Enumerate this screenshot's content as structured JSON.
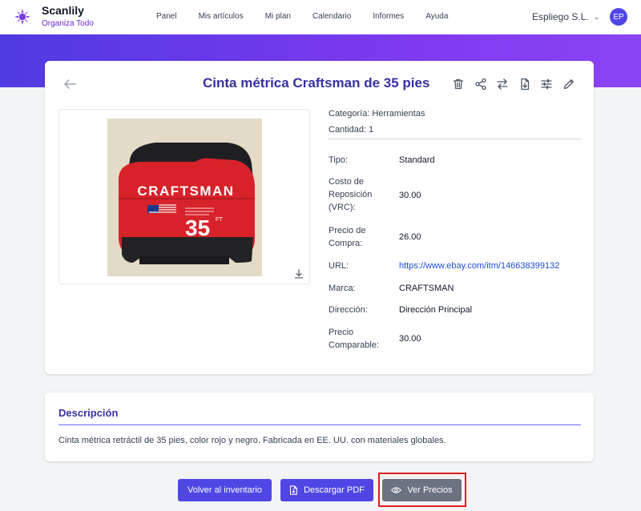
{
  "brand": {
    "name": "Scanlily",
    "tagline": "Organiza Todo",
    "icon": "sun-logo-icon",
    "color": "#7c3aed"
  },
  "nav": {
    "items": [
      "Panel",
      "Mis artículos",
      "Mi plan",
      "Calendario",
      "Informes",
      "Ayuda"
    ]
  },
  "account": {
    "company": "Espliego S.L.",
    "initials": "EP"
  },
  "item": {
    "title": "Cinta métrica Craftsman de 35 pies",
    "category": "Categoría: Herramientas",
    "quantity": "Cantidad: 1",
    "actions": [
      "trash-icon",
      "share-icon",
      "transfer-icon",
      "download-file-icon",
      "sliders-icon",
      "edit-icon"
    ],
    "photo_text": {
      "brand": "CRAFTSMAN",
      "size": "35",
      "unit": "FT"
    },
    "details": [
      {
        "label": "Tipo:",
        "value": "Standard"
      },
      {
        "label": "Costo de Reposición (VRC):",
        "value": "30.00"
      },
      {
        "label": "Precio de Compra:",
        "value": "26.00"
      },
      {
        "label": "URL:",
        "value": "https://www.ebay.com/itm/146638399132"
      },
      {
        "label": "Marca:",
        "value": "CRAFTSMAN"
      },
      {
        "label": "Dirección:",
        "value": "Dirección Principal"
      },
      {
        "label": "Precio Comparable:",
        "value": "30.00"
      }
    ]
  },
  "description": {
    "title": "Descripción",
    "text": "Cinta métrica retráctil de 35 pies, color rojo y negro. Fabricada en EE. UU. con materiales globales."
  },
  "buttons": {
    "back": "Volver al inventario",
    "pdf": "Descargar PDF",
    "prices": "Ver Precios"
  },
  "colors": {
    "accent": "#4f46e5",
    "title": "#3730a3",
    "highlight": "#e11d1d",
    "link": "#1d4ed8"
  }
}
